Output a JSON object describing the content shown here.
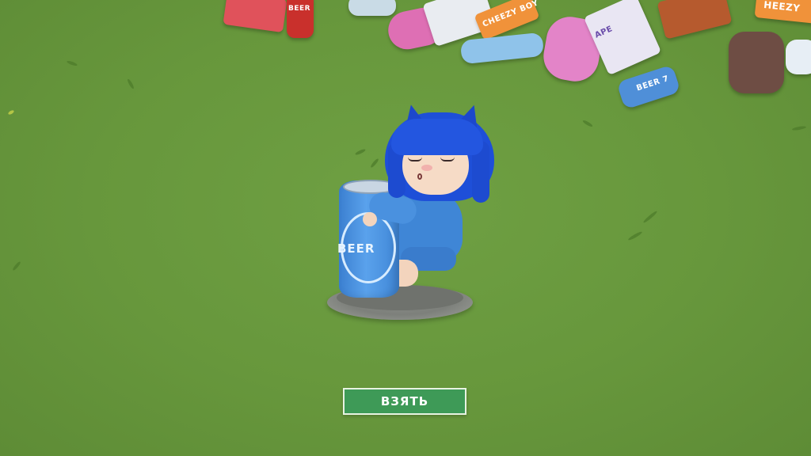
{
  "ui": {
    "take_button_label": "ВЗЯТЬ"
  },
  "item_labels": {
    "beer_small": "BEER",
    "cheezy_a": "CHEEZY BOY",
    "cheezy_b": "HEEZY",
    "grape": "APE",
    "can_brand": "BEER",
    "can_lid_text": "BEER 7"
  },
  "colors": {
    "grass": "#67973c",
    "take_button": "#3e9a57",
    "hair": "#1e4fd8",
    "hoodie": "#3f86d6",
    "pedestal": "#7d807b"
  },
  "icons": {
    "character": "blue-haired-cat-eared-chibi-icon",
    "can": "beer-can-icon",
    "pile": "item-pile"
  }
}
